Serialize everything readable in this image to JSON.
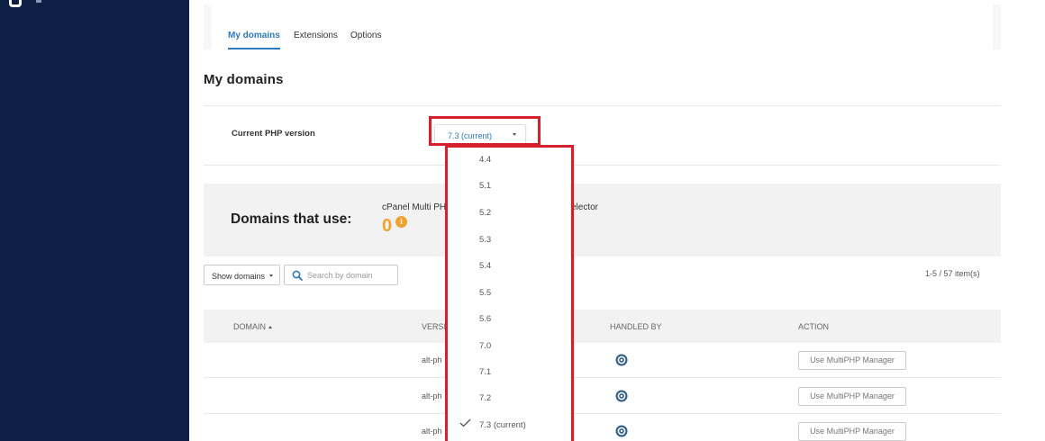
{
  "tabs": [
    {
      "label": "My domains",
      "active": true
    },
    {
      "label": "Extensions",
      "active": false
    },
    {
      "label": "Options",
      "active": false
    }
  ],
  "page_title": "My domains",
  "php_version": {
    "label": "Current PHP version",
    "selected": "7.3 (current)",
    "options": [
      "4.4",
      "5.1",
      "5.2",
      "5.3",
      "5.4",
      "5.5",
      "5.6",
      "7.0",
      "7.1",
      "7.2",
      "7.3 (current)"
    ]
  },
  "domains_panel": {
    "title": "Domains that use:",
    "subtitle_left": "cPanel Multi PH",
    "subtitle_right": "elector",
    "count": "0",
    "info_icon": "info-icon"
  },
  "toolbar": {
    "show_domains_label": "Show domains",
    "search_placeholder": "Search by domain",
    "pagination": "1-5 / 57 item(s)"
  },
  "table": {
    "columns": [
      "DOMAIN",
      "VERSI",
      "HANDLED BY",
      "ACTION"
    ],
    "rows": [
      {
        "version": "alt-ph",
        "handled_by_icon": "cpanel-icon",
        "action": "Use MultiPHP Manager"
      },
      {
        "version": "alt-ph",
        "handled_by_icon": "cpanel-icon",
        "action": "Use MultiPHP Manager"
      },
      {
        "version": "alt-ph",
        "handled_by_icon": "cpanel-icon",
        "action": "Use MultiPHP Manager"
      }
    ]
  },
  "colors": {
    "sidebar": "#0d1f45",
    "accent": "#2d7bbf",
    "highlight_box": "#d51f2a",
    "count": "#f0a22e"
  }
}
